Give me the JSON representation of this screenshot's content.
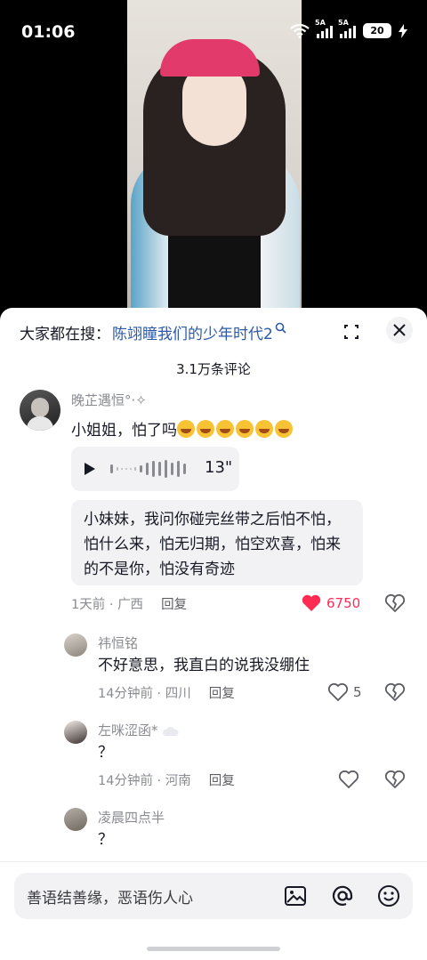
{
  "status_bar": {
    "time": "01:06",
    "battery": "20",
    "net1": "5A",
    "net2": "5A"
  },
  "search_suggest": {
    "prefix": "大家都在搜：",
    "term": "陈翊瞳我们的少年时代2"
  },
  "comments_count": "3.1万条评论",
  "comment_main": {
    "username": "晚芷遇恒°·✧",
    "text": "小姐姐，怕了吗",
    "emoji_count": 6,
    "voice_duration": "13\"",
    "quote_text": "小妹妹，我问你碰完丝带之后怕不怕，怕什么来，怕无归期，怕空欢喜，怕来的不是你，怕没有奇迹",
    "time": "1天前",
    "location": "广西",
    "reply_label": "回复",
    "likes": "6750"
  },
  "replies": [
    {
      "username": "祎恒铭",
      "text": "不好意思，我直白的说我没绷住",
      "time": "14分钟前",
      "location": "四川",
      "reply_label": "回复",
      "likes": "5"
    },
    {
      "username": "左咪涩函*",
      "text": "？",
      "time": "14分钟前",
      "location": "河南",
      "reply_label": "回复",
      "likes": ""
    },
    {
      "username": "凌晨四点半",
      "text": "？"
    }
  ],
  "input": {
    "placeholder": "善语结善缘，恶语伤人心"
  },
  "colors": {
    "link": "#2b5aa8",
    "like_active": "#fe2c55",
    "sheet_bg": "#ffffff"
  }
}
